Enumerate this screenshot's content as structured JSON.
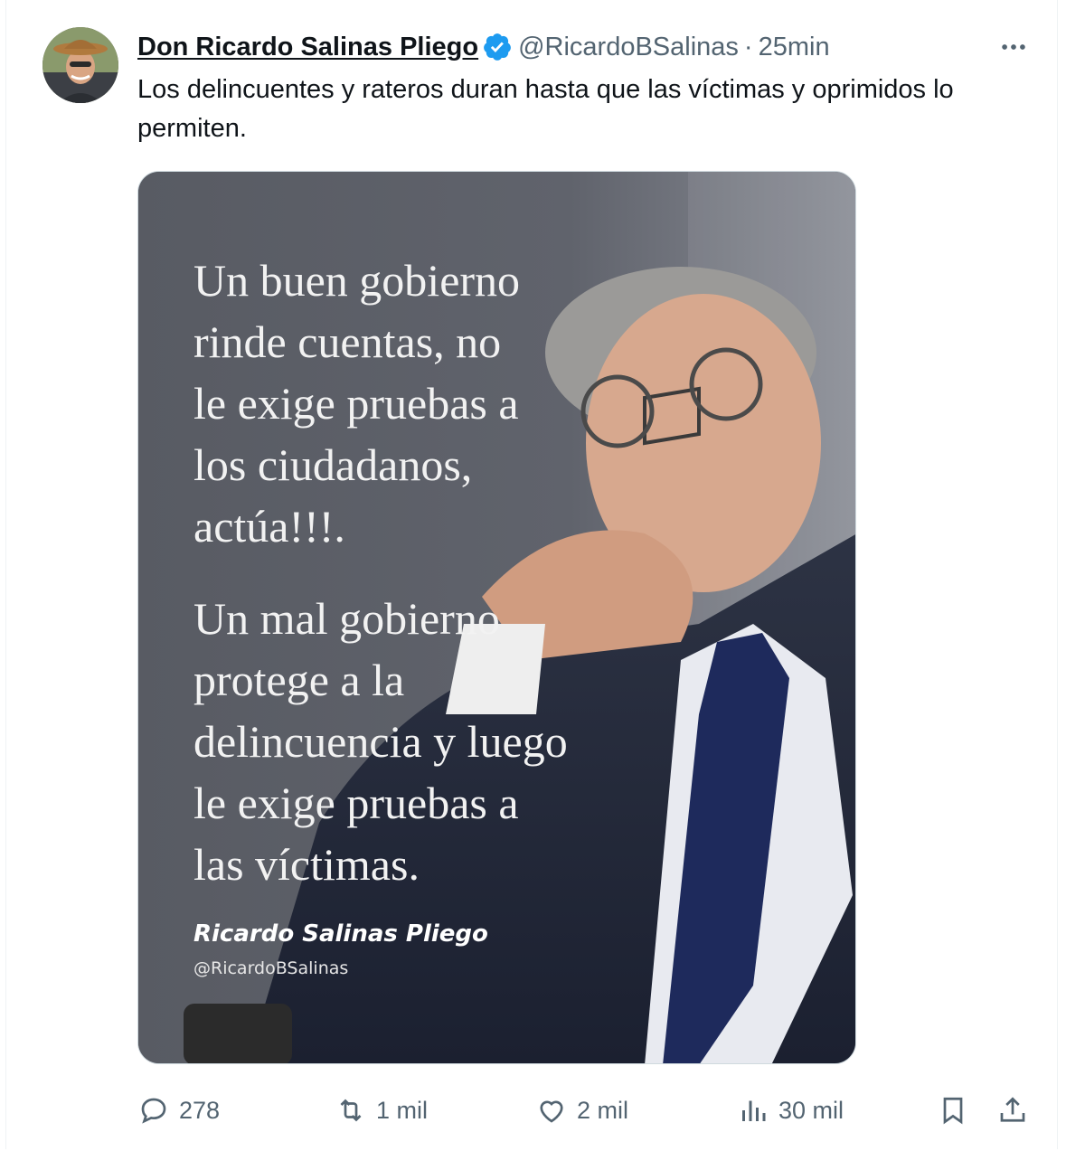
{
  "author": {
    "display_name": "Don Ricardo Salinas Pliego",
    "verified_icon": "verified-badge-icon",
    "handle": "@RicardoBSalinas",
    "separator": "·",
    "time_ago": "25min"
  },
  "more_icon": "more-options-icon",
  "tweet": {
    "text": "Los delincuentes y rateros duran hasta que las víctimas y oprimidos lo permiten."
  },
  "media": {
    "quote_part_1": "Un buen gobierno\nrinde cuentas, no\nle exige pruebas a\nlos ciudadanos,\nactúa!!!.",
    "quote_part_2": "Un mal gobierno\nprotege a la\ndelincuencia y luego\nle exige pruebas a\nlas víctimas.",
    "signature_name": "Ricardo Salinas Pliego",
    "signature_handle": "@RicardoBSalinas"
  },
  "actions": {
    "replies": "278",
    "reposts": "1 mil",
    "likes": "2 mil",
    "views": "30 mil",
    "icons": [
      "reply-icon",
      "repost-icon",
      "like-icon",
      "views-icon",
      "bookmark-icon",
      "share-icon"
    ]
  },
  "colors": {
    "text_primary": "#0f1419",
    "text_secondary": "#536471",
    "verified_blue": "#1d9bf0",
    "media_background": "#5a5d66"
  }
}
